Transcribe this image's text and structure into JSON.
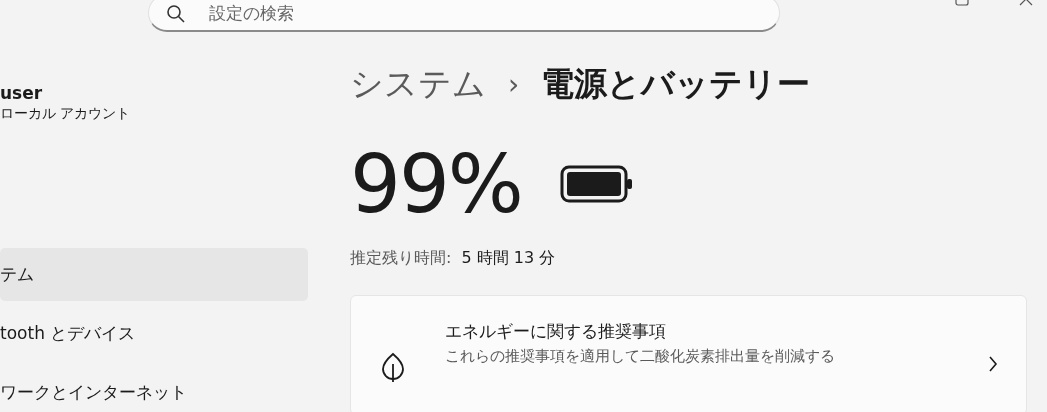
{
  "search": {
    "placeholder": "設定の検索"
  },
  "account": {
    "name": "user",
    "type": "ローカル アカウント"
  },
  "sidebar": {
    "items": [
      {
        "label": "テム",
        "selected": true
      },
      {
        "label": "tooth とデバイス",
        "selected": false
      },
      {
        "label": "ワークとインターネット",
        "selected": false
      }
    ]
  },
  "breadcrumb": {
    "parent": "システム",
    "separator": "›",
    "current": "電源とバッテリー"
  },
  "battery": {
    "percent": "99%",
    "estimate_label": "推定残り時間:",
    "estimate_value": "5 時間 13 分"
  },
  "card": {
    "title": "エネルギーに関する推奨事項",
    "subtitle": "これらの推奨事項を適用して二酸化炭素排出量を削減する"
  }
}
